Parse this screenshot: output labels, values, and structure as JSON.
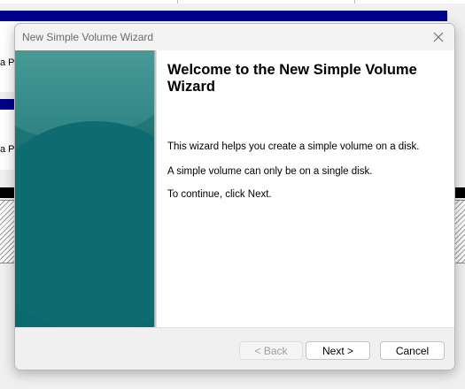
{
  "background": {
    "row_label_1": "a Pa",
    "row_label_2": "a Pa"
  },
  "dialog": {
    "title": "New Simple Volume Wizard",
    "close_icon": "close-icon",
    "heading": "Welcome to the New Simple Volume Wizard",
    "paragraphs": [
      "This wizard helps you create a simple volume on a disk.",
      "A simple volume can only be on a single disk.",
      "To continue, click Next."
    ],
    "buttons": {
      "back": "< Back",
      "next": "Next >",
      "cancel": "Cancel"
    },
    "colors": {
      "side_panel": "#0b6970",
      "selection_bar": "#00008b"
    }
  }
}
